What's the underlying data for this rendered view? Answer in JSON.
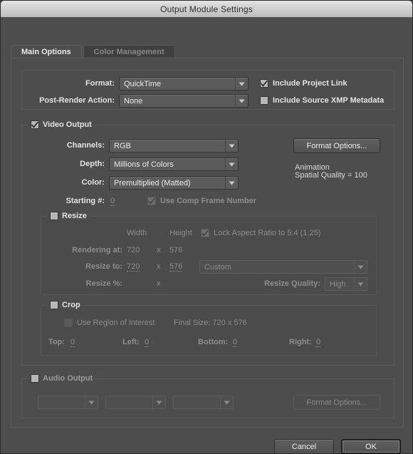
{
  "window": {
    "title": "Output Module Settings"
  },
  "tabs": [
    {
      "label": "Main Options",
      "active": true
    },
    {
      "label": "Color Management",
      "active": false
    }
  ],
  "format_group": {
    "format_label": "Format:",
    "format_value": "QuickTime",
    "post_render_label": "Post-Render Action:",
    "post_render_value": "None",
    "include_project_link": {
      "label": "Include Project Link",
      "checked": true
    },
    "include_xmp": {
      "label": "Include Source XMP Metadata",
      "checked": false
    }
  },
  "video_output": {
    "legend": "Video Output",
    "checked": true,
    "channels_label": "Channels:",
    "channels_value": "RGB",
    "depth_label": "Depth:",
    "depth_value": "Millions of Colors",
    "color_label": "Color:",
    "color_value": "Premultiplied (Matted)",
    "starting_label": "Starting #:",
    "starting_value": "0",
    "use_comp_frame_number": {
      "label": "Use Comp Frame Number",
      "checked": true
    },
    "format_options_button": "Format Options...",
    "codec_name": "Animation",
    "codec_quality": "Spatial Quality = 100"
  },
  "resize": {
    "legend": "Resize",
    "checked": false,
    "width_header": "Width",
    "height_header": "Height",
    "lock_aspect": {
      "label": "Lock Aspect Ratio to 5:4 (1.25)",
      "checked": true
    },
    "rendering_at_label": "Rendering at:",
    "rendering_at_width": "720",
    "rendering_at_height": "576",
    "resize_to_label": "Resize to:",
    "resize_to_width": "720",
    "resize_to_height": "576",
    "resize_preset": "Custom",
    "resize_percent_label": "Resize %:",
    "resize_percent_value": "",
    "times": "x",
    "resize_quality_label": "Resize Quality:",
    "resize_quality_value": "High"
  },
  "crop": {
    "legend": "Crop",
    "checked": false,
    "use_region_of_interest": {
      "label": "Use Region of Interest",
      "checked": false
    },
    "final_size": "Final Size: 720 x 576",
    "top_label": "Top:",
    "top_value": "0",
    "left_label": "Left:",
    "left_value": "0",
    "bottom_label": "Bottom:",
    "bottom_value": "0",
    "right_label": "Right:",
    "right_value": "0"
  },
  "audio_output": {
    "legend": "Audio Output",
    "checked": false,
    "rate_value": "",
    "depth_value": "",
    "channels_value": "",
    "format_options_button": "Format Options..."
  },
  "footer": {
    "cancel_label": "Cancel",
    "ok_label": "OK"
  },
  "colors": {
    "dialog_bg": "#4d4d4d",
    "titlebar_top": "#e4e4e4",
    "text_enabled": "#e3e3e3",
    "text_disabled": "#8d8d8d",
    "dropdown_bg": "#5b5b5b"
  }
}
